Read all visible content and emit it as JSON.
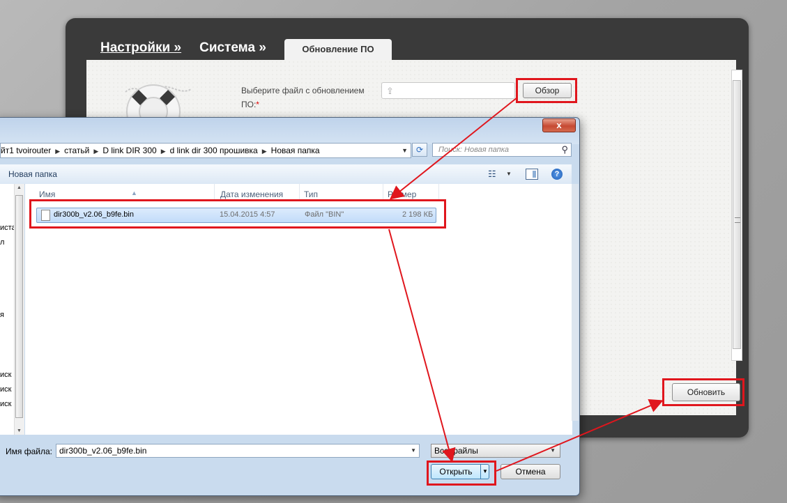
{
  "router": {
    "breadcrumb": [
      {
        "label": "Настройки »"
      },
      {
        "label": "Система »"
      }
    ],
    "active_tab": "Обновление ПО",
    "file_label": "Выберите файл с обновлением ПО:",
    "required_mark": "*",
    "browse_button": "Обзор",
    "update_button": "Обновить"
  },
  "dialog": {
    "address_segments": [
      "йт1 tvoirouter",
      "статьй",
      "D link DIR 300",
      "d link dir 300 прошивка",
      "Новая папка"
    ],
    "search_placeholder": "Поиск: Новая папка",
    "new_folder": "Новая папка",
    "columns": {
      "name": "Имя",
      "date": "Дата изменения",
      "type": "Тип",
      "size": "Размер"
    },
    "files": [
      {
        "name": "dir300b_v2.06_b9fe.bin",
        "date": "15.04.2015 4:57",
        "type": "Файл \"BIN\"",
        "size": "2 198 КБ"
      }
    ],
    "nav_items": [
      "иста",
      "л",
      "я",
      "иск",
      "иск",
      "иск"
    ],
    "filename_label": "Имя файла:",
    "filename_value": "dir300b_v2.06_b9fe.bin",
    "filetype_value": "Все файлы",
    "open_button": "Открыть",
    "cancel_button": "Отмена",
    "close_glyph": "x",
    "help_glyph": "?"
  },
  "colors": {
    "highlight": "#e0161d",
    "router_frame": "#3a3a3a",
    "selection": "#c2dcfa"
  }
}
